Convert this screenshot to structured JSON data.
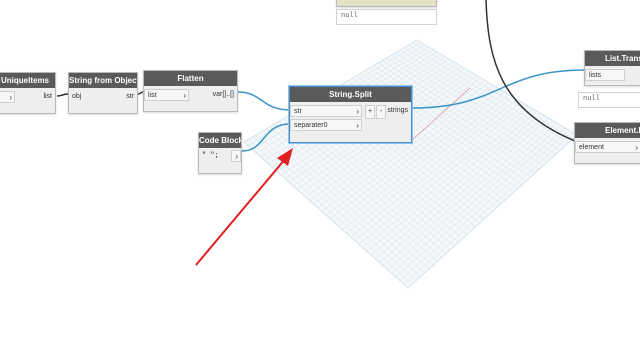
{
  "nodes": {
    "unique_items": {
      "title": "UniqueItems",
      "output": "list",
      "arrow": "›"
    },
    "string_from_object": {
      "title": "String from Object",
      "input": "obj",
      "output": "str"
    },
    "flatten": {
      "title": "Flatten",
      "input": "list",
      "output": "var[]..[]",
      "arrow": "›"
    },
    "code_block": {
      "title": "Code Block",
      "code": "\" \";",
      "arrow": "›"
    },
    "string_split": {
      "title": "String.Split",
      "input1": "str",
      "input2": "separater0",
      "output": "strings",
      "arrow": "›",
      "plus": "+",
      "minus": "-",
      "lacing": "⁞"
    },
    "list_transpose": {
      "title": "List.Transpose",
      "input": "lists"
    },
    "element_id": {
      "title": "Element.Id",
      "input": "element",
      "arrow": "›"
    }
  },
  "previews": {
    "top_null": "null",
    "right_null": "null"
  },
  "colors": {
    "wire": "#3a94c8",
    "wire_dark": "#333333",
    "arrow": "#e02020",
    "selection": "#4a8fd0"
  }
}
